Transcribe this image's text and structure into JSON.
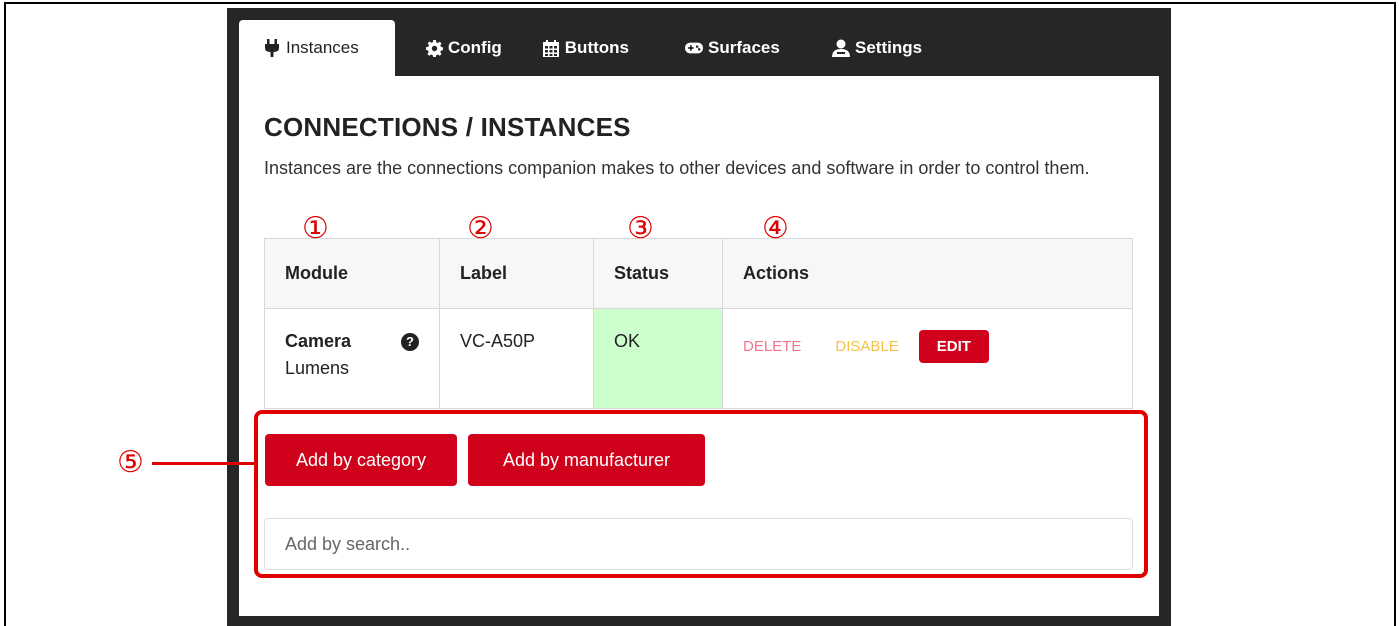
{
  "tabs": [
    {
      "label": "Instances",
      "icon": "plug-icon",
      "active": true
    },
    {
      "label": "Config",
      "icon": "gear-icon",
      "active": false
    },
    {
      "label": "Buttons",
      "icon": "calendar-grid-icon",
      "active": false
    },
    {
      "label": "Surfaces",
      "icon": "gamepad-icon",
      "active": false
    },
    {
      "label": "Settings",
      "icon": "user-gear-icon",
      "active": false
    }
  ],
  "page": {
    "title": "CONNECTIONS / INSTANCES",
    "description": "Instances are the connections companion makes to other devices and software in order to control them."
  },
  "table": {
    "headers": [
      "Module",
      "Label",
      "Status",
      "Actions"
    ],
    "rows": [
      {
        "module_name": "Camera",
        "module_vendor": "Lumens",
        "label": "VC-A50P",
        "status": "OK",
        "actions": {
          "delete": "DELETE",
          "disable": "DISABLE",
          "edit": "EDIT"
        }
      }
    ]
  },
  "add": {
    "by_category": "Add by category",
    "by_manufacturer": "Add by manufacturer",
    "search_placeholder": "Add by search.."
  },
  "callouts": [
    "①",
    "②",
    "③",
    "④",
    "⑤"
  ],
  "colors": {
    "accent": "#d0021b",
    "annotation": "#e00000",
    "status_ok_bg": "#ccffcc",
    "delete": "#f0758a",
    "disable": "#f6c146",
    "app_bg": "#262626"
  }
}
